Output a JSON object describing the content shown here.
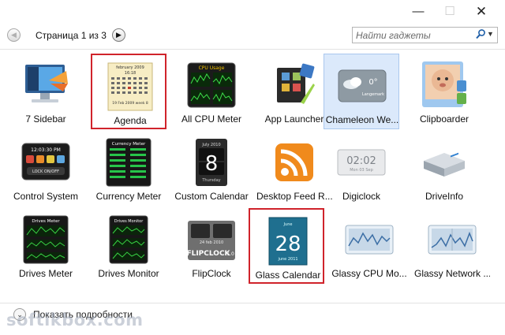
{
  "window": {
    "minimize_glyph": "—",
    "maximize_glyph": "☐",
    "close_glyph": "✕"
  },
  "nav": {
    "page_label": "Страница 1 из 3",
    "prev_glyph": "◀",
    "next_glyph": "▶"
  },
  "search": {
    "placeholder": "Найти гаджеты",
    "icon": "search-icon",
    "dropdown_glyph": "▼"
  },
  "gadgets": [
    {
      "label": "7 Sidebar",
      "icon": "monitor-icon"
    },
    {
      "label": "Agenda",
      "icon": "agenda-calendar-icon",
      "thumb_title": "february 2009",
      "thumb_time": "16:18",
      "thumb_footer": "19 Feb 2009 week 8"
    },
    {
      "label": "All CPU Meter",
      "icon": "cpu-meter-icon",
      "thumb_title": "CPU Usage"
    },
    {
      "label": "App Launcher",
      "icon": "app-launcher-icon"
    },
    {
      "label": "Chameleon We...",
      "icon": "weather-icon",
      "thumb_temp": "0°",
      "thumb_city": "Langemark"
    },
    {
      "label": "Clipboarder",
      "icon": "baby-photo-icon"
    },
    {
      "label": "Control System",
      "icon": "control-system-icon",
      "thumb_time": "12:03:30 PM",
      "thumb_text": "LOCK ON/OFF"
    },
    {
      "label": "Currency Meter",
      "icon": "currency-meter-icon",
      "thumb_title": "Currency Meter"
    },
    {
      "label": "Custom Calendar",
      "icon": "custom-calendar-icon",
      "thumb_month": "July 2010",
      "thumb_day": "8",
      "thumb_weekday": "Thursday"
    },
    {
      "label": "Desktop Feed R...",
      "icon": "rss-feed-icon"
    },
    {
      "label": "Digiclock",
      "icon": "digiclock-icon",
      "thumb_time": "02:02",
      "thumb_date": "Mon 03 Sep"
    },
    {
      "label": "DriveInfo",
      "icon": "drive-icon"
    },
    {
      "label": "Drives Meter",
      "icon": "drives-meter-icon",
      "thumb_title": "Drives Meter"
    },
    {
      "label": "Drives Monitor",
      "icon": "drives-monitor-icon",
      "thumb_title": "Drives Monitor"
    },
    {
      "label": "FlipClock",
      "icon": "flipclock-icon",
      "thumb_text": "FLIPCLOCK",
      "thumb_version": "1.0",
      "thumb_date": "24 feb 2010"
    },
    {
      "label": "Glass Calendar",
      "icon": "glass-calendar-icon",
      "thumb_month": "June",
      "thumb_day": "28",
      "thumb_footer": "june 2011"
    },
    {
      "label": "Glassy CPU Mo...",
      "icon": "glassy-cpu-icon"
    },
    {
      "label": "Glassy Network ...",
      "icon": "glassy-network-icon"
    }
  ],
  "details": {
    "label": "Показать подробности",
    "glyph": "⌄"
  },
  "watermark": {
    "text": "softikbox.com"
  },
  "colors": {
    "selection": "#dbe9fb",
    "highlight_box": "#d0232b"
  }
}
